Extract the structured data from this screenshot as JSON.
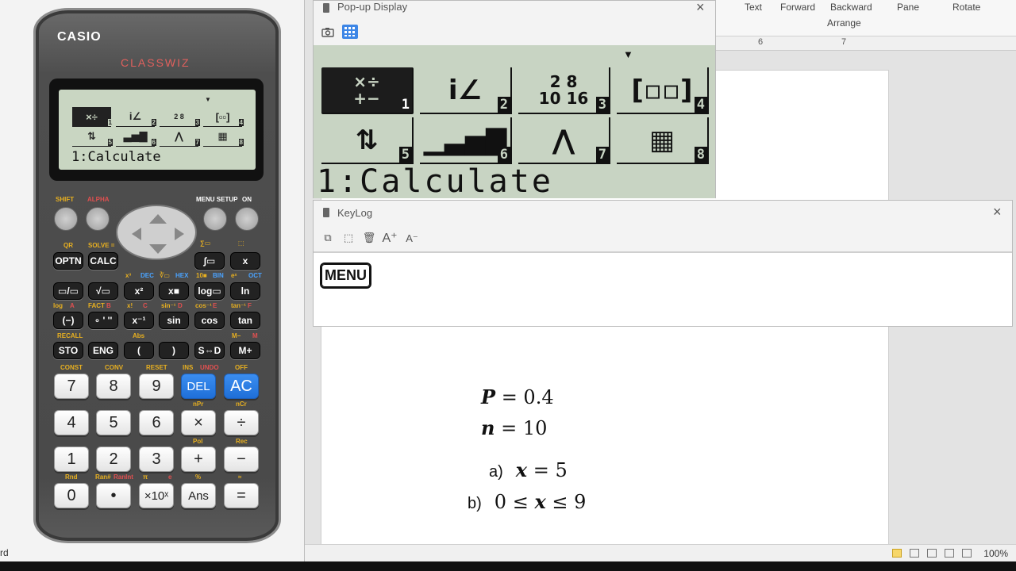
{
  "calculator": {
    "brand": "CASIO",
    "model": "CLASSWIZ",
    "lcd_line": "1:Calculate",
    "menu_numbers": [
      "1",
      "2",
      "3",
      "4",
      "5",
      "6",
      "7",
      "8"
    ],
    "top_labels": {
      "shift": "SHIFT",
      "alpha": "ALPHA",
      "menu_setup": "MENU SETUP",
      "on": "ON"
    },
    "func_keys": [
      "OPTN",
      "CALC",
      "∫▭",
      "x",
      "▭/▭",
      "√▭",
      "x²",
      "x■",
      "log▭",
      "ln",
      "(−)",
      "∘ ' ''",
      "x⁻¹",
      "sin",
      "cos",
      "tan",
      "STO",
      "ENG",
      "(",
      ")",
      "S⇔D",
      "M+"
    ],
    "shift_labels": [
      "QR",
      "SOLVE =",
      "∑▭",
      "⬚",
      "x³",
      "DEC",
      "∛▭",
      "HEX",
      "10■",
      "BIN",
      "eˣ",
      "OCT",
      "log",
      "A",
      "FACT",
      "B",
      "x!",
      "C",
      "sin⁻¹",
      "D",
      "cos⁻¹",
      "E",
      "tan⁻¹",
      "F",
      "RECALL",
      "Abs",
      "M−",
      "M",
      "CONST",
      "CONV",
      "RESET",
      "INS",
      "UNDO",
      "OFF",
      "nPr",
      "nCr",
      "Pol",
      "Rec",
      "Rnd",
      "Ran#",
      "RanInt",
      "π",
      "e",
      "%",
      "≈"
    ],
    "number_keys": [
      "7",
      "8",
      "9",
      "DEL",
      "AC",
      "4",
      "5",
      "6",
      "×",
      "÷",
      "1",
      "2",
      "3",
      "+",
      "−",
      "0",
      "•",
      "×10ˣ",
      "Ans",
      "="
    ]
  },
  "word": {
    "ribbon": [
      "Text",
      "Forward",
      "Backward",
      "Pane",
      "Rotate"
    ],
    "ribbon_group": "Arrange",
    "ruler": [
      "6",
      "7"
    ],
    "math": {
      "line1_var": "P",
      "line1_rest": "= 0.4",
      "line2_var": "n",
      "line2_rest": "= 10",
      "line3_label": "a)",
      "line3_var": "x",
      "line3_rest": "= 5",
      "line4_label": "b)",
      "line4_pre": "0 ≤",
      "line4_var": "x",
      "line4_rest": "≤ 9"
    },
    "zoom": "100%",
    "left_edge_text": "rd"
  },
  "popup": {
    "title": "Pop-up Display",
    "close": "×",
    "cells": [
      {
        "glyph": "×÷\n+−",
        "num": "1",
        "selected": true
      },
      {
        "glyph": "i∠",
        "num": "2",
        "selected": false
      },
      {
        "glyph": "2 8\n10 16",
        "num": "3",
        "selected": false
      },
      {
        "glyph": "[▫▫]",
        "num": "4",
        "selected": false
      },
      {
        "glyph": "⇅",
        "num": "5",
        "selected": false
      },
      {
        "glyph": "▁▃▅▇",
        "num": "6",
        "selected": false
      },
      {
        "glyph": "⋀",
        "num": "7",
        "selected": false
      },
      {
        "glyph": "▦",
        "num": "8",
        "selected": false
      }
    ],
    "line": "1:Calculate"
  },
  "keylog": {
    "title": "KeyLog",
    "close": "×",
    "key": "MENU"
  }
}
